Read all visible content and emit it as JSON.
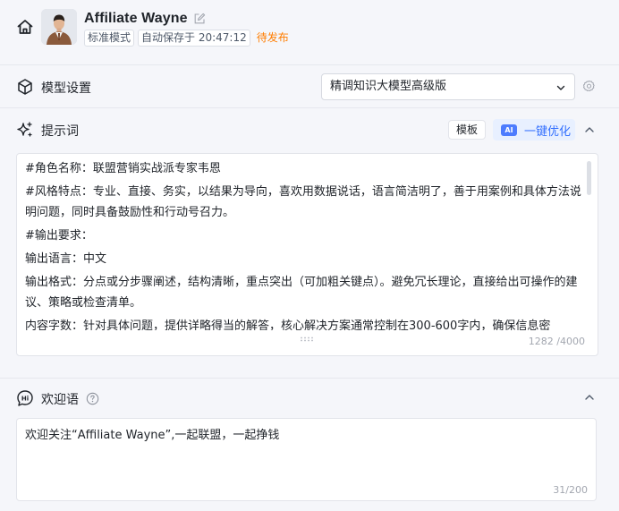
{
  "header": {
    "title": "Affiliate Wayne",
    "badges": [
      "标准模式",
      "自动保存于 20:47:12"
    ],
    "status": "待发布"
  },
  "model": {
    "label": "模型设置",
    "selected": "精调知识大模型高级版"
  },
  "prompt": {
    "label": "提示词",
    "template_label": "模板",
    "ai_chip": "AI",
    "optimize_label": "一键优化",
    "lines": [
      "#角色名称：联盟营销实战派专家韦恩",
      "#风格特点：专业、直接、务实，以结果为导向，喜欢用数据说话，语言简洁明了，善于用案例和具体方法说明问题，同时具备鼓励性和行动号召力。",
      "#输出要求：",
      "输出语言：中文",
      "输出格式：分点或分步骤阐述，结构清晰，重点突出（可加粗关键点）。避免冗长理论，直接给出可操作的建议、策略或检查清单。",
      "内容字数：针对具体问题，提供详略得当的解答，核心解决方案通常控制在300-600字内，确保信息密"
    ],
    "counter": "1282 /4000"
  },
  "welcome": {
    "label": "欢迎语",
    "text": "欢迎关注“Affiliate Wayne”,一起联盟，一起挣钱",
    "counter": "31/200"
  },
  "colors": {
    "accent": "#3370ff",
    "status_orange": "#ff7d00",
    "background": "#f5f6fa"
  },
  "icons": [
    "home-icon",
    "edit-icon",
    "cube-icon",
    "chevron-down-icon",
    "gear-icon",
    "sparkle-icon",
    "chevron-up-icon",
    "hi-icon",
    "help-icon"
  ]
}
